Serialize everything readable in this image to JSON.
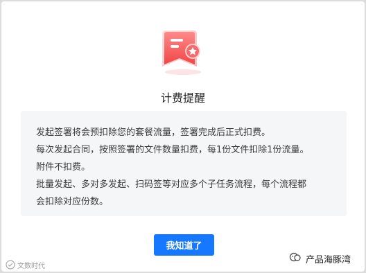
{
  "dialog": {
    "icon": "certificate-icon",
    "title": "计费提醒",
    "message_lines": [
      "发起签署将会预扣除您的套餐流量，签署完成后正式扣费。",
      "每次发起合同，按照签署的文件数量扣费，每1份文件扣除1份流量。",
      "附件不扣费。",
      "批量发起、多对多发起、扫码签等对应多个子任务流程，每个流程都",
      "会扣除对应份数。"
    ],
    "confirm_label": "我知道了"
  },
  "watermarks": {
    "left_text": "文数时代",
    "right_text": "产品海豚湾",
    "right_icon": "wechat-official-account-icon"
  },
  "colors": {
    "accent": "#1677ff",
    "icon_red": "#f15a5a",
    "panel_bg": "#f5f6f8"
  }
}
